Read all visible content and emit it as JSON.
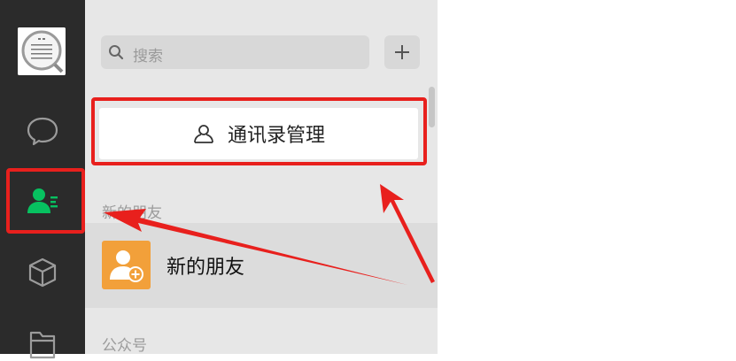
{
  "search": {
    "placeholder": "搜索",
    "icon": "search-icon"
  },
  "toolbar": {
    "add_icon": "plus-icon"
  },
  "contacts": {
    "manage_label": "通讯录管理",
    "section_new_friends": "新的朋友",
    "new_friends_label": "新的朋友",
    "section_official": "公众号"
  },
  "rail": {
    "items": [
      {
        "icon": "chat-icon"
      },
      {
        "icon": "contacts-icon",
        "active": true
      },
      {
        "icon": "cube-icon"
      },
      {
        "icon": "folder-icon"
      }
    ]
  },
  "colors": {
    "rail_bg": "#2b2b2b",
    "list_bg": "#e7e7e7",
    "active_green": "#07c160",
    "highlight_red": "#e8201d",
    "new_friend_orange": "#f2a03a"
  }
}
